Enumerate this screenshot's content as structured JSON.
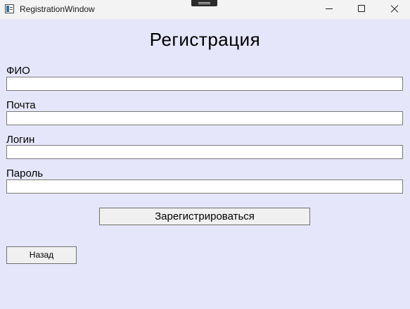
{
  "window": {
    "title": "RegistrationWindow"
  },
  "form": {
    "heading": "Регистрация",
    "fields": [
      {
        "label": "ФИО",
        "value": ""
      },
      {
        "label": "Почта",
        "value": ""
      },
      {
        "label": "Логин",
        "value": ""
      },
      {
        "label": "Пароль",
        "value": ""
      }
    ],
    "register_label": "Зарегистрироваться",
    "back_label": "Назад"
  },
  "colors": {
    "background": "#e6e6fa",
    "titlebar": "#f3f3f3"
  },
  "icons": {
    "app": "app-window-icon",
    "minimize": "minimize-icon",
    "maximize": "maximize-icon",
    "close": "close-icon"
  }
}
